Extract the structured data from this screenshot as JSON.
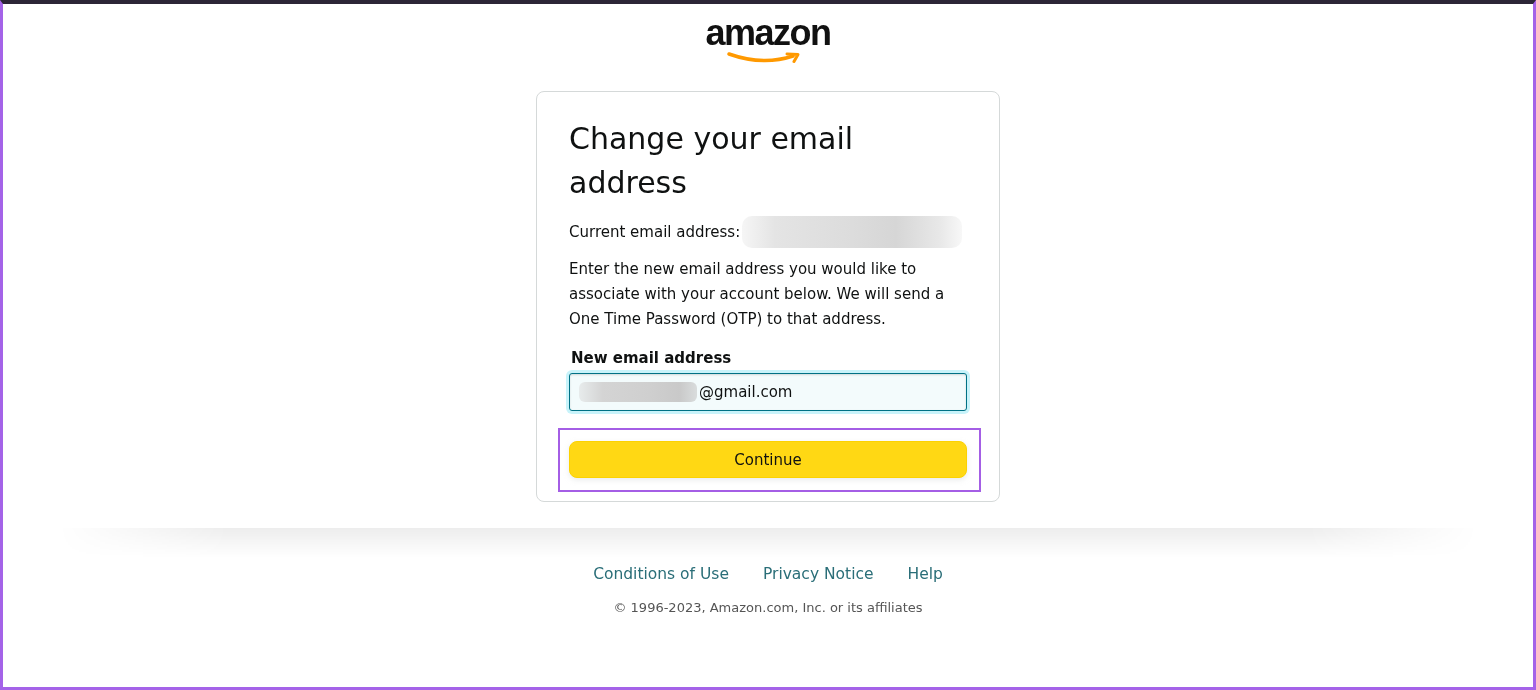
{
  "logo": {
    "text": "amazon"
  },
  "card": {
    "title": "Change your email address",
    "current_email": {
      "label": "Current email address:",
      "redacted": true
    },
    "instructions": "Enter the new email address you would like to associate with your account below. We will send a One Time Password (OTP) to that address.",
    "new_email": {
      "label": "New email address",
      "value": "@gmail.com",
      "redacted_prefix": true,
      "focused": true
    },
    "continue_button": {
      "label": "Continue",
      "highlighted": true
    }
  },
  "footer": {
    "links": [
      "Conditions of Use",
      "Privacy Notice",
      "Help"
    ],
    "copyright": "© 1996-2023, Amazon.com, Inc. or its affiliates"
  }
}
